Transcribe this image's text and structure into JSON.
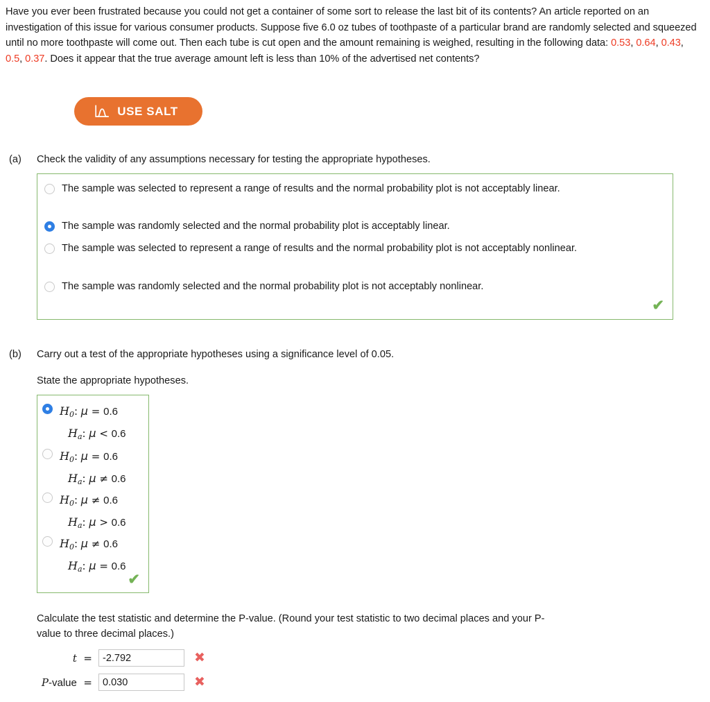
{
  "problem": {
    "text_before_data": "Have you ever been frustrated because you could not get a container of some sort to release the last bit of its contents? An article reported on an investigation of this issue for various consumer products. Suppose five 6.0 oz tubes of toothpaste of a particular brand are randomly selected and squeezed until no more toothpaste will come out. Then each tube is cut open and the amount remaining is weighed, resulting in the following data: ",
    "data_values": [
      "0.53",
      "0.64",
      "0.43",
      "0.5",
      "0.37"
    ],
    "data_separator": ", ",
    "text_after_data": ". Does it appear that the true average amount left is less than 10% of the advertised net contents?"
  },
  "salt_button": {
    "label": "USE SALT",
    "icon": "normal-curve-icon",
    "background_color": "#e8722f",
    "text_color": "#ffffff"
  },
  "parts": {
    "a": {
      "label": "(a)",
      "prompt": "Check the validity of any assumptions necessary for testing the appropriate hypotheses.",
      "options": [
        {
          "id": "a-opt-1",
          "text": "The sample was selected to represent a range of results and the normal probability plot is not acceptably linear.",
          "selected": false
        },
        {
          "id": "a-opt-2",
          "text": "The sample was randomly selected and the normal probability plot is acceptably linear.",
          "selected": true
        },
        {
          "id": "a-opt-3",
          "text": "The sample was selected to represent a range of results and the normal probability plot is not acceptably nonlinear.",
          "selected": false
        },
        {
          "id": "a-opt-4",
          "text": "The sample was randomly selected and the normal probability plot is not acceptably nonlinear.",
          "selected": false
        }
      ],
      "feedback": "correct",
      "feedback_glyph": "✔",
      "feedback_color": "#74b356"
    },
    "b": {
      "label": "(b)",
      "prompt": "Carry out a test of the appropriate hypotheses using a significance level of 0.05.",
      "subprompt": "State the appropriate hypotheses.",
      "hypothesis_options": [
        {
          "id": "b-opt-1",
          "selected": true,
          "null": {
            "symbol": "H",
            "sub": "0",
            "param": "μ",
            "operator": "=",
            "value": "0.6"
          },
          "alt": {
            "symbol": "H",
            "sub": "a",
            "param": "μ",
            "operator": "<",
            "value": "0.6"
          }
        },
        {
          "id": "b-opt-2",
          "selected": false,
          "null": {
            "symbol": "H",
            "sub": "0",
            "param": "μ",
            "operator": "=",
            "value": "0.6"
          },
          "alt": {
            "symbol": "H",
            "sub": "a",
            "param": "μ",
            "operator": "≠",
            "value": "0.6"
          }
        },
        {
          "id": "b-opt-3",
          "selected": false,
          "null": {
            "symbol": "H",
            "sub": "0",
            "param": "μ",
            "operator": "≠",
            "value": "0.6"
          },
          "alt": {
            "symbol": "H",
            "sub": "a",
            "param": "μ",
            "operator": ">",
            "value": "0.6"
          }
        },
        {
          "id": "b-opt-4",
          "selected": false,
          "null": {
            "symbol": "H",
            "sub": "0",
            "param": "μ",
            "operator": "≠",
            "value": "0.6"
          },
          "alt": {
            "symbol": "H",
            "sub": "a",
            "param": "μ",
            "operator": "=",
            "value": "0.6"
          }
        }
      ],
      "feedback": "correct",
      "feedback_glyph": "✔",
      "feedback_color": "#74b356",
      "calc_prompt_line1": "Calculate the test statistic and determine the P-value. (Round your test statistic to two decimal places and your P-",
      "calc_prompt_line2": "value to three decimal places.)",
      "fields": [
        {
          "id": "t-field",
          "label_italic": "t",
          "label_plain": "",
          "equals": "=",
          "value": "-2.792",
          "status": "incorrect",
          "status_glyph": "✖",
          "status_color": "#e8615f"
        },
        {
          "id": "p-value-field",
          "label_italic": "P",
          "label_plain": "-value",
          "equals": "=",
          "value": "0.030",
          "status": "incorrect",
          "status_glyph": "✖",
          "status_color": "#e8615f"
        }
      ]
    }
  }
}
